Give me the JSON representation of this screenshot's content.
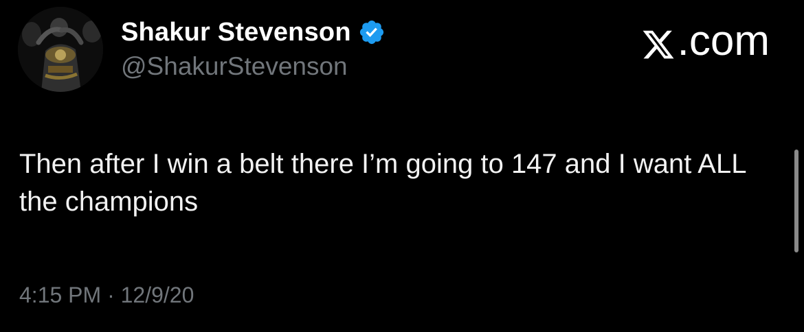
{
  "author": {
    "display_name": "Shakur Stevenson",
    "handle": "@ShakurStevenson",
    "verified_icon": "verified-badge-icon",
    "verified_color": "#1d9bf0"
  },
  "brand": {
    "label": ".com",
    "logo_icon": "x-logo-icon"
  },
  "tweet": {
    "text": "Then after I win a belt there I’m going to 147 and I want ALL the champions",
    "timestamp": "4:15 PM · 12/9/20"
  },
  "colors": {
    "background": "#000000",
    "primary_text": "#ffffff",
    "secondary_text": "#71767b"
  }
}
